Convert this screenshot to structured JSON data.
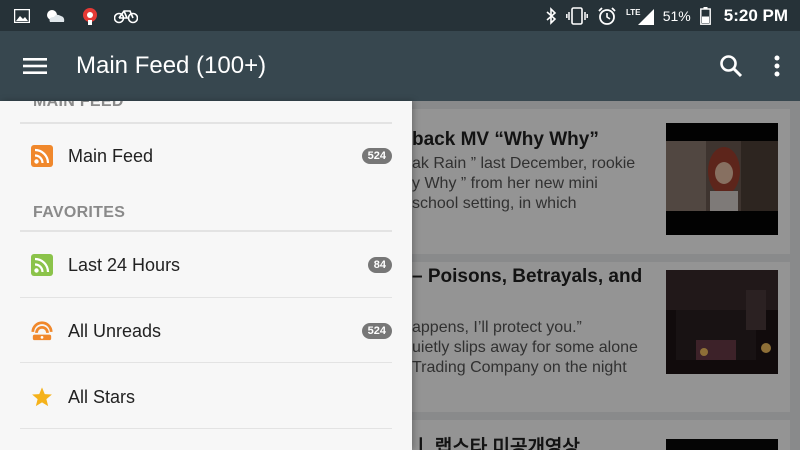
{
  "status_bar": {
    "battery_percent": "51%",
    "time": "5:20 PM",
    "network_type": "LTE",
    "icons_left": [
      "image-icon",
      "weather-icon",
      "app-icon",
      "bike-icon"
    ],
    "icons_right": [
      "bluetooth-icon",
      "vibrate-icon",
      "alarm-icon",
      "lte-icon",
      "battery-icon"
    ]
  },
  "toolbar": {
    "title": "Main Feed (100+)",
    "menu_icon": "hamburger-icon",
    "search_icon": "search-icon",
    "overflow_icon": "more-vert-icon"
  },
  "drawer": {
    "top_section_partial": "MAIN FEED",
    "main_feed": {
      "label": "Main Feed",
      "count": "524",
      "icon": "rss-icon"
    },
    "favorites_header": "FAVORITES",
    "favorites": [
      {
        "label": "Last 24 Hours",
        "count": "84",
        "icon": "rss-green-icon"
      },
      {
        "label": "All Unreads",
        "count": "524",
        "icon": "unread-feed-icon"
      },
      {
        "label": "All Stars",
        "count": "",
        "icon": "star-icon"
      }
    ]
  },
  "feed": {
    "articles": [
      {
        "title_visible": "back MV “Why Why”",
        "snippet_visible": "ak Rain ” last December, rookie\ny Why ” from her new mini\nschool setting, in which"
      },
      {
        "title_visible": "– Poisons, Betrayals, and",
        "snippet_visible": "appens, I’ll protect you.”\nuietly slips away for some alone\nTrading Company on the night"
      },
      {
        "title_visible": "ㅣ 랩스타 미공개영상"
      }
    ]
  },
  "colors": {
    "status_bar_bg": "#263238",
    "toolbar_bg": "#37474f",
    "drawer_bg": "#f7f7f7",
    "badge_bg": "#777777",
    "rss_orange": "#f0882c",
    "rss_green": "#8bc34a",
    "star_yellow": "#f5b21a"
  }
}
